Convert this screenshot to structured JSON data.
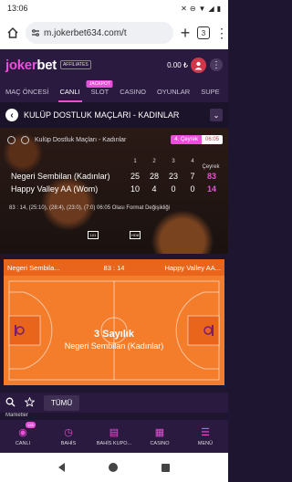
{
  "status": {
    "time": "13:06"
  },
  "browser": {
    "url": "m.jokerbet634.com/t",
    "tab_count": "3"
  },
  "header": {
    "logo_main": "joker",
    "logo_accent": "bet",
    "affiliate": "AFFILIATES",
    "balance": "0.00 ₺"
  },
  "nav": {
    "items": [
      "MAÇ ÖNCESİ",
      "CANLI",
      "SLOT",
      "CASINO",
      "OYUNLAR",
      "SUPE"
    ],
    "jackpot": "JACKPOT"
  },
  "title": "KULÜP DOSTLUK MAÇLARI - KADINLAR",
  "scoreboard": {
    "competition": "Kulüp Dostluk Maçları - Kadınlar",
    "period": "4. Çeyrek",
    "clock": "06:05",
    "quarter_labels": [
      "1",
      "2",
      "3",
      "4"
    ],
    "total_label": "Çeyrek",
    "teams": [
      {
        "name": "Negeri Sembilan (Kadınlar)",
        "q": [
          "25",
          "28",
          "23",
          "7"
        ],
        "total": "83"
      },
      {
        "name": "Happy Valley AA (Wom)",
        "q": [
          "10",
          "4",
          "0",
          "0"
        ],
        "total": "14"
      }
    ],
    "info": "83 : 14, (25:10), (28:4), (23:0), (7:0) 06:05 Olası Format Değişikliği",
    "icon_left": "101",
    "icon_right": "HD8"
  },
  "court": {
    "home": "Negeri Sembila...",
    "score": "83 : 14",
    "away": "Happy Valley AA...",
    "event": "3 Sayılık",
    "event_team": "Negeri Sembilan (Kadınlar)"
  },
  "filter": {
    "all_label": "TÜMÜ"
  },
  "markets_label": "Marketler",
  "bottom_nav": {
    "items": [
      "CANLI",
      "BAHİS",
      "BAHİS KUPO...",
      "CASINO",
      "MENÜ"
    ],
    "live_badge": "125"
  }
}
